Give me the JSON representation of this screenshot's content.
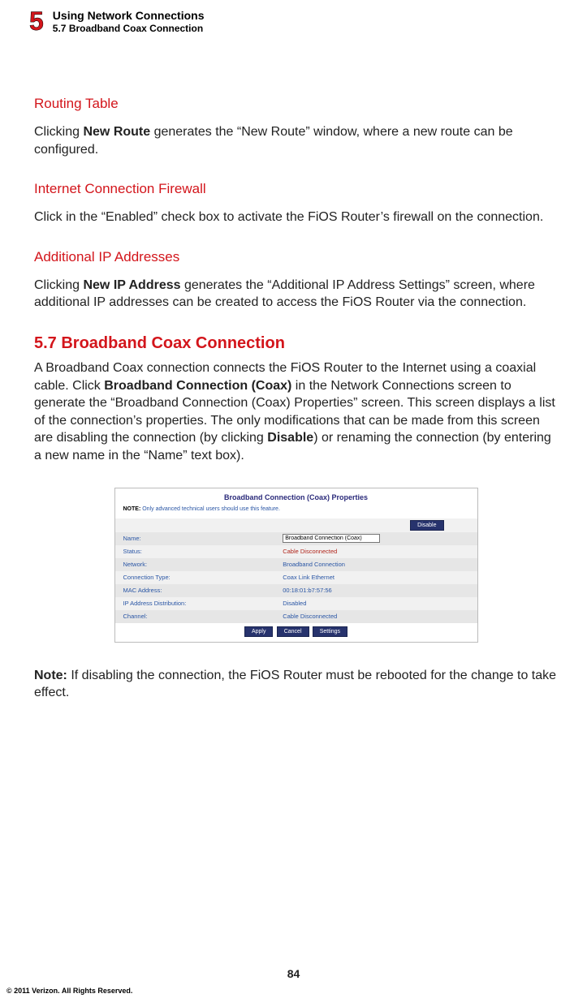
{
  "header": {
    "chapter_number": "5",
    "chapter_title": "Using Network Connections",
    "section_label": "5.7  Broadband Coax Connection"
  },
  "sections": {
    "routing": {
      "title": "Routing Table",
      "text_pre": "Clicking ",
      "text_bold": "New Route",
      "text_post": " generates the “New Route” window, where a new route can be configured."
    },
    "firewall": {
      "title": "Internet Connection Firewall",
      "text": "Click in the “Enabled” check box to activate the FiOS Router’s firewall on the connection."
    },
    "additional_ip": {
      "title": "Additional IP Addresses",
      "text_pre": "Clicking ",
      "text_bold": "New IP Address",
      "text_post": " generates the “Additional IP Address Settings” screen, where additional IP addresses can be created to access the FiOS Router via the connection."
    }
  },
  "main_section": {
    "title": "5.7  Broadband Coax Connection",
    "para_pre": "A Broadband Coax connection connects the FiOS Router to the Internet using a coaxial cable. Click ",
    "para_bold1": "Broadband Connection (Coax)",
    "para_mid": " in the Network Connections screen to generate the “Broadband Connection (Coax) Properties” screen. This screen displays a list of the connection’s properties. The only modifications that can be made from this screen are disabling the connection (by clicking ",
    "para_bold2": "Disable",
    "para_post": ") or renaming the connection (by entering a new name in the “Name” text box)."
  },
  "screenshot": {
    "title": "Broadband Connection (Coax) Properties",
    "note_label": "NOTE:",
    "note_text": "Only advanced technical users should use this feature.",
    "disable_button": "Disable",
    "name_input_value": "Broadband Connection (Coax)",
    "rows": [
      {
        "label": "Name:",
        "value": "",
        "is_input": true
      },
      {
        "label": "Status:",
        "value": "Cable Disconnected",
        "red": true
      },
      {
        "label": "Network:",
        "value": "Broadband Connection"
      },
      {
        "label": "Connection Type:",
        "value": "Coax Link Ethernet"
      },
      {
        "label": "MAC Address:",
        "value": "00:18:01:b7:57:56"
      },
      {
        "label": "IP Address Distribution:",
        "value": "Disabled"
      },
      {
        "label": "Channel:",
        "value": "Cable Disconnected"
      }
    ],
    "buttons": {
      "apply": "Apply",
      "cancel": "Cancel",
      "settings": "Settings"
    }
  },
  "note": {
    "label": "Note:",
    "text": " If disabling the connection, the FiOS Router must be rebooted for the change to take effect."
  },
  "footer": {
    "page_number": "84",
    "copyright": "© 2011 Verizon. All Rights Reserved."
  }
}
